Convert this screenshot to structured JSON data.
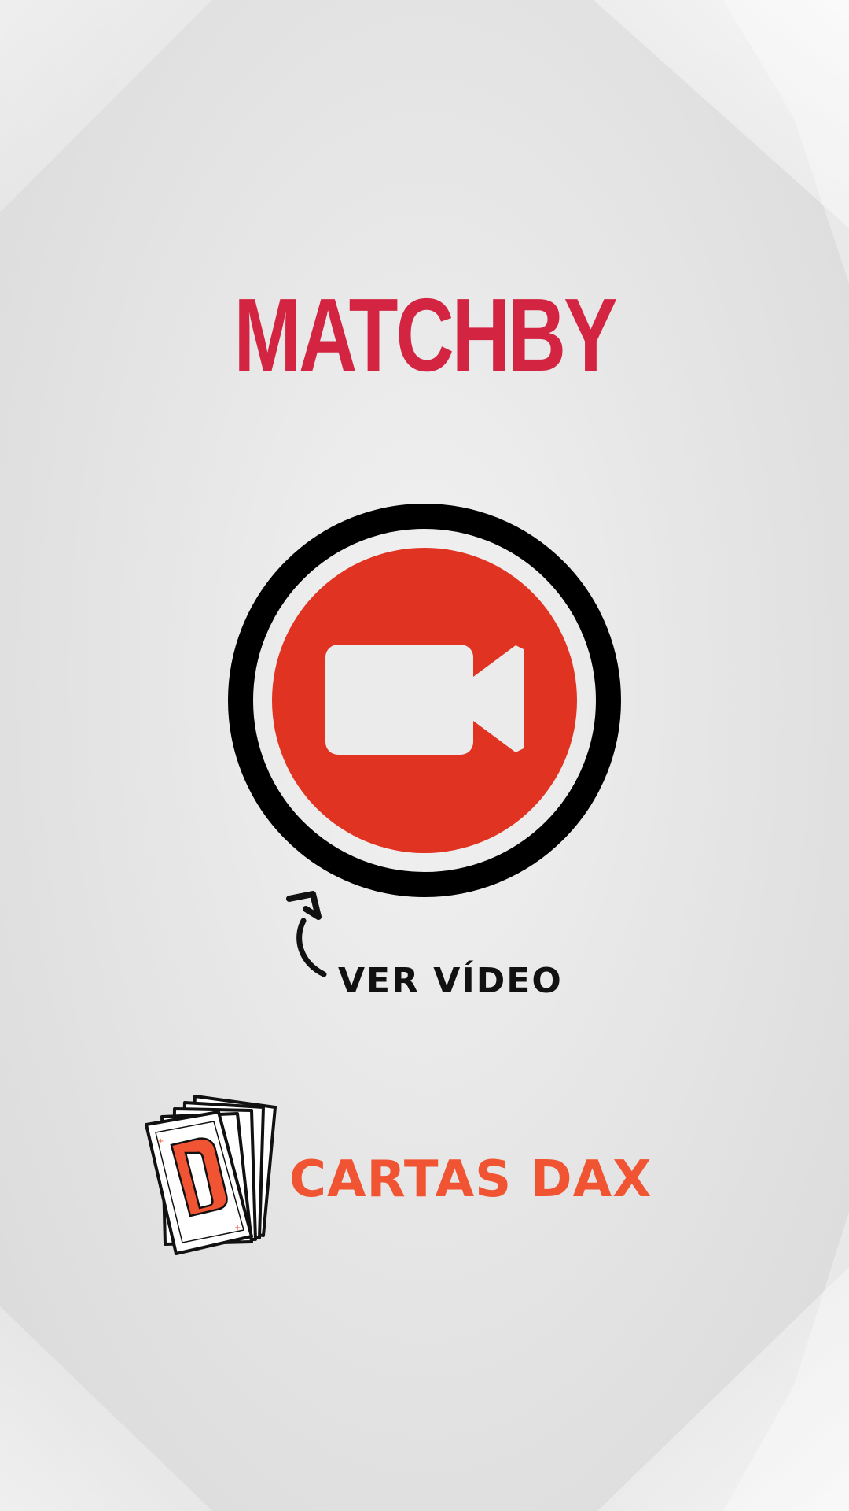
{
  "title": "MATCHBY",
  "video_button": {
    "icon": "video-camera-icon",
    "colors": {
      "fill": "#e13321",
      "ring": "#000000",
      "icon": "#ebebeb"
    }
  },
  "cta": {
    "label": "VER VÍDEO",
    "icon": "curved-arrow-up-icon"
  },
  "brand": {
    "name": "CARTAS DAX",
    "logo": "card-deck-logo",
    "logo_letter": "D",
    "color": "#f05432"
  },
  "colors": {
    "title": "#d32541",
    "background": "#e6e6e6"
  }
}
